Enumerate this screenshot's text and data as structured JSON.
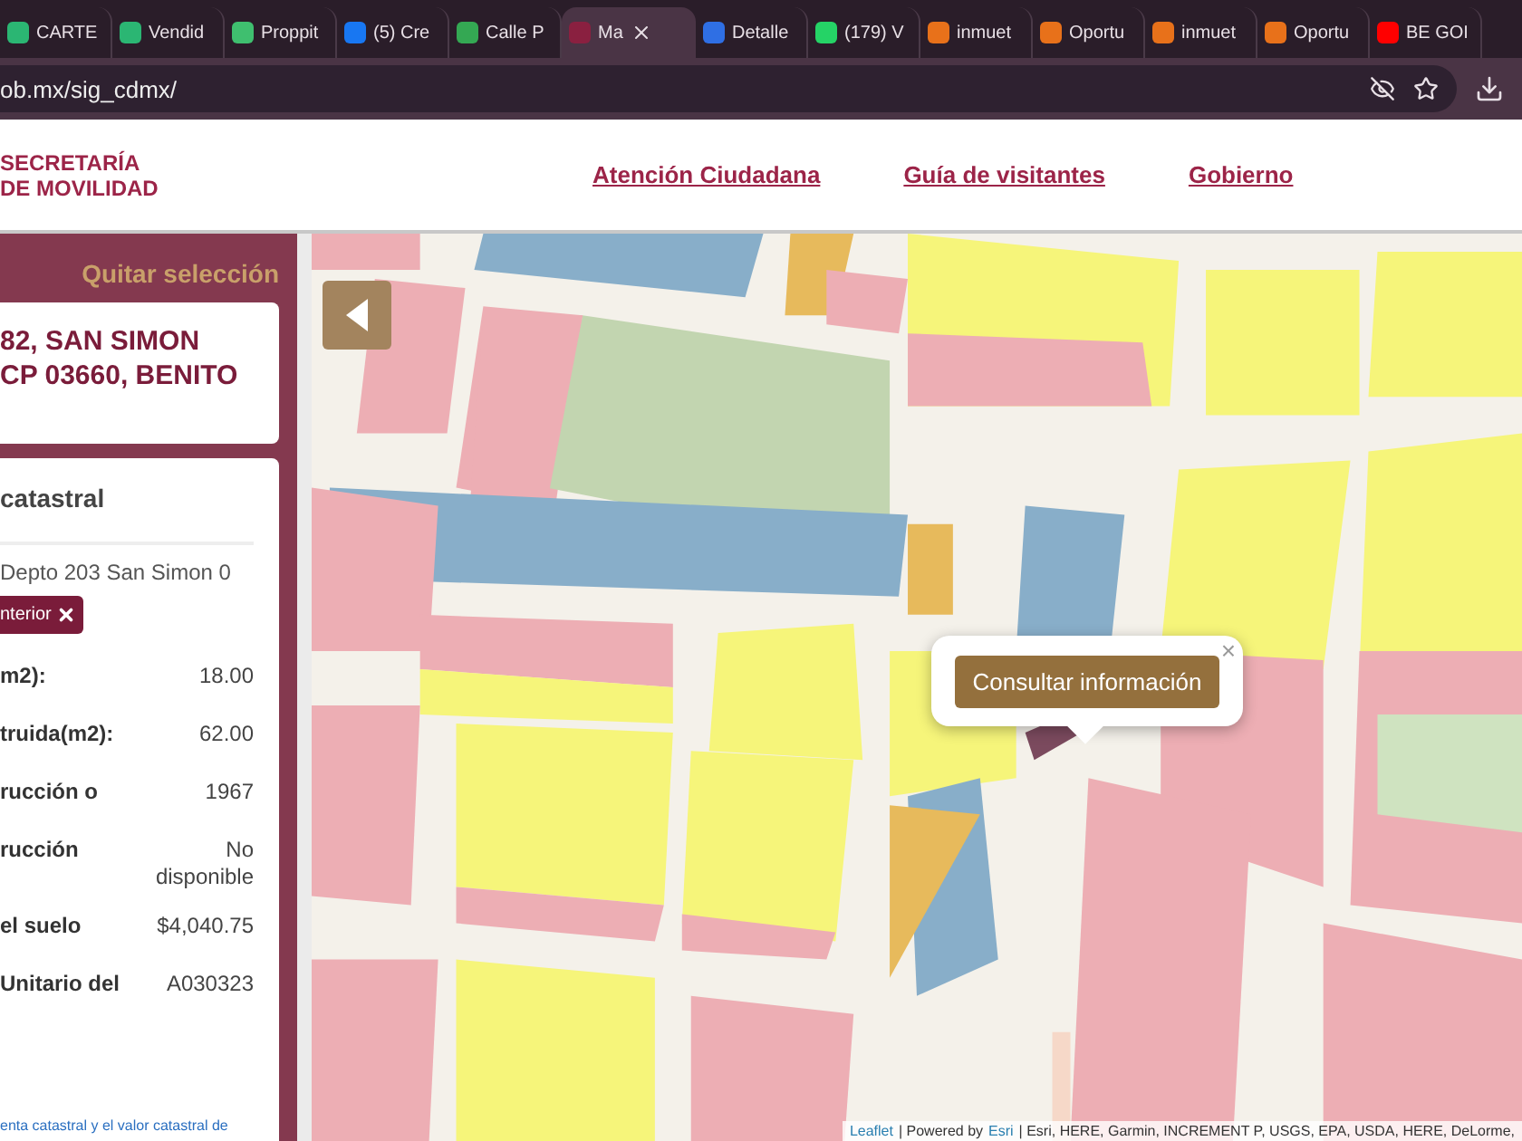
{
  "browser": {
    "tabs": [
      {
        "label": "CARTE",
        "selected": false,
        "color": "#2bb673"
      },
      {
        "label": "Vendid",
        "selected": false,
        "color": "#2bb673"
      },
      {
        "label": "Proppit",
        "selected": false,
        "color": "#3fbf6f"
      },
      {
        "label": "(5) Cre",
        "selected": false,
        "color": "#1877f2"
      },
      {
        "label": "Calle P",
        "selected": false,
        "color": "#34a853"
      },
      {
        "label": "Ma",
        "selected": true,
        "color": "#8a2040"
      },
      {
        "label": "Detalle",
        "selected": false,
        "color": "#2f6fe4"
      },
      {
        "label": "(179) V",
        "selected": false,
        "color": "#25d366"
      },
      {
        "label": "inmuet",
        "selected": false,
        "color": "#e8711a"
      },
      {
        "label": "Oportu",
        "selected": false,
        "color": "#e8711a"
      },
      {
        "label": "inmuet",
        "selected": false,
        "color": "#e8711a"
      },
      {
        "label": "Oportu",
        "selected": false,
        "color": "#e8711a"
      },
      {
        "label": "BE GOI",
        "selected": false,
        "color": "#ff0000"
      }
    ],
    "address": "ob.mx/sig_cdmx/"
  },
  "header": {
    "logo_lines": [
      "SECRETARÍA",
      "DE MOVILIDAD"
    ],
    "nav": [
      "Atención Ciudadana",
      "Guía de visitantes",
      "Gobierno"
    ]
  },
  "panel": {
    "clear_selection": "Quitar selección",
    "address_lines": [
      "82, SAN SIMON",
      "CP 03660, BENITO"
    ],
    "card": {
      "title": "catastral",
      "item": "Depto 203 San Simon 0",
      "back_button": "nterior",
      "rows": [
        {
          "label": "m2):",
          "value": "18.00"
        },
        {
          "label": "truida(m2):",
          "value": "62.00"
        },
        {
          "label": "rucción o",
          "value": "1967"
        },
        {
          "label": "rucción",
          "value": "No disponible"
        },
        {
          "label": "el suelo",
          "value": "$4,040.75"
        },
        {
          "label": "Unitario del",
          "value": "A030323"
        }
      ],
      "footnote": "enta catastral y el valor catastral de"
    }
  },
  "map": {
    "popup": {
      "button": "Consultar información",
      "close": "×"
    },
    "attribution": {
      "leaflet": "Leaflet",
      "powered": "| Powered by",
      "esri": "Esri",
      "sources": "| Esri, HERE, Garmin, INCREMENT P, USGS, EPA, USDA, HERE, DeLorme,"
    }
  }
}
